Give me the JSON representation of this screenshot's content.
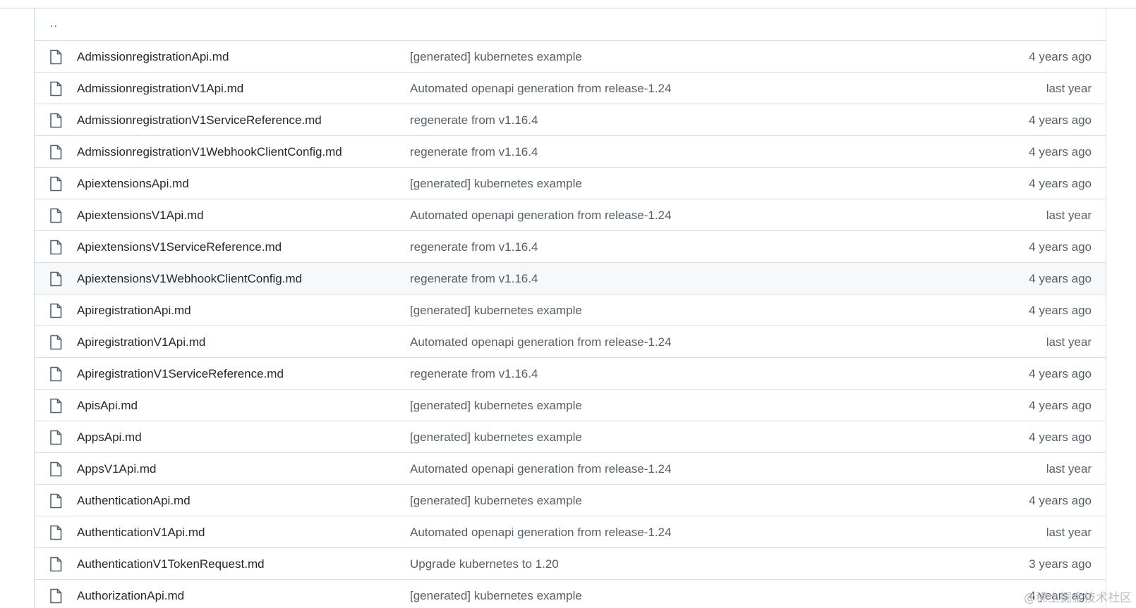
{
  "parent_link": "..",
  "files": [
    {
      "name": "AdmissionregistrationApi.md",
      "message": "[generated] kubernetes example",
      "age": "4 years ago"
    },
    {
      "name": "AdmissionregistrationV1Api.md",
      "message": "Automated openapi generation from release-1.24",
      "age": "last year"
    },
    {
      "name": "AdmissionregistrationV1ServiceReference.md",
      "message": "regenerate from v1.16.4",
      "age": "4 years ago"
    },
    {
      "name": "AdmissionregistrationV1WebhookClientConfig.md",
      "message": "regenerate from v1.16.4",
      "age": "4 years ago"
    },
    {
      "name": "ApiextensionsApi.md",
      "message": "[generated] kubernetes example",
      "age": "4 years ago"
    },
    {
      "name": "ApiextensionsV1Api.md",
      "message": "Automated openapi generation from release-1.24",
      "age": "last year"
    },
    {
      "name": "ApiextensionsV1ServiceReference.md",
      "message": "regenerate from v1.16.4",
      "age": "4 years ago"
    },
    {
      "name": "ApiextensionsV1WebhookClientConfig.md",
      "message": "regenerate from v1.16.4",
      "age": "4 years ago",
      "hovered": true
    },
    {
      "name": "ApiregistrationApi.md",
      "message": "[generated] kubernetes example",
      "age": "4 years ago"
    },
    {
      "name": "ApiregistrationV1Api.md",
      "message": "Automated openapi generation from release-1.24",
      "age": "last year"
    },
    {
      "name": "ApiregistrationV1ServiceReference.md",
      "message": "regenerate from v1.16.4",
      "age": "4 years ago"
    },
    {
      "name": "ApisApi.md",
      "message": "[generated] kubernetes example",
      "age": "4 years ago"
    },
    {
      "name": "AppsApi.md",
      "message": "[generated] kubernetes example",
      "age": "4 years ago"
    },
    {
      "name": "AppsV1Api.md",
      "message": "Automated openapi generation from release-1.24",
      "age": "last year"
    },
    {
      "name": "AuthenticationApi.md",
      "message": "[generated] kubernetes example",
      "age": "4 years ago"
    },
    {
      "name": "AuthenticationV1Api.md",
      "message": "Automated openapi generation from release-1.24",
      "age": "last year"
    },
    {
      "name": "AuthenticationV1TokenRequest.md",
      "message": "Upgrade kubernetes to 1.20",
      "age": "3 years ago"
    },
    {
      "name": "AuthorizationApi.md",
      "message": "[generated] kubernetes example",
      "age": "4 years ago"
    }
  ],
  "icon": "file-icon",
  "colors": {
    "link": "#0969da",
    "text": "#24292f",
    "muted": "#57606a",
    "border": "#d0d7de",
    "hover": "#f6f8fa"
  },
  "watermark": "@稀土掘金技术社区"
}
